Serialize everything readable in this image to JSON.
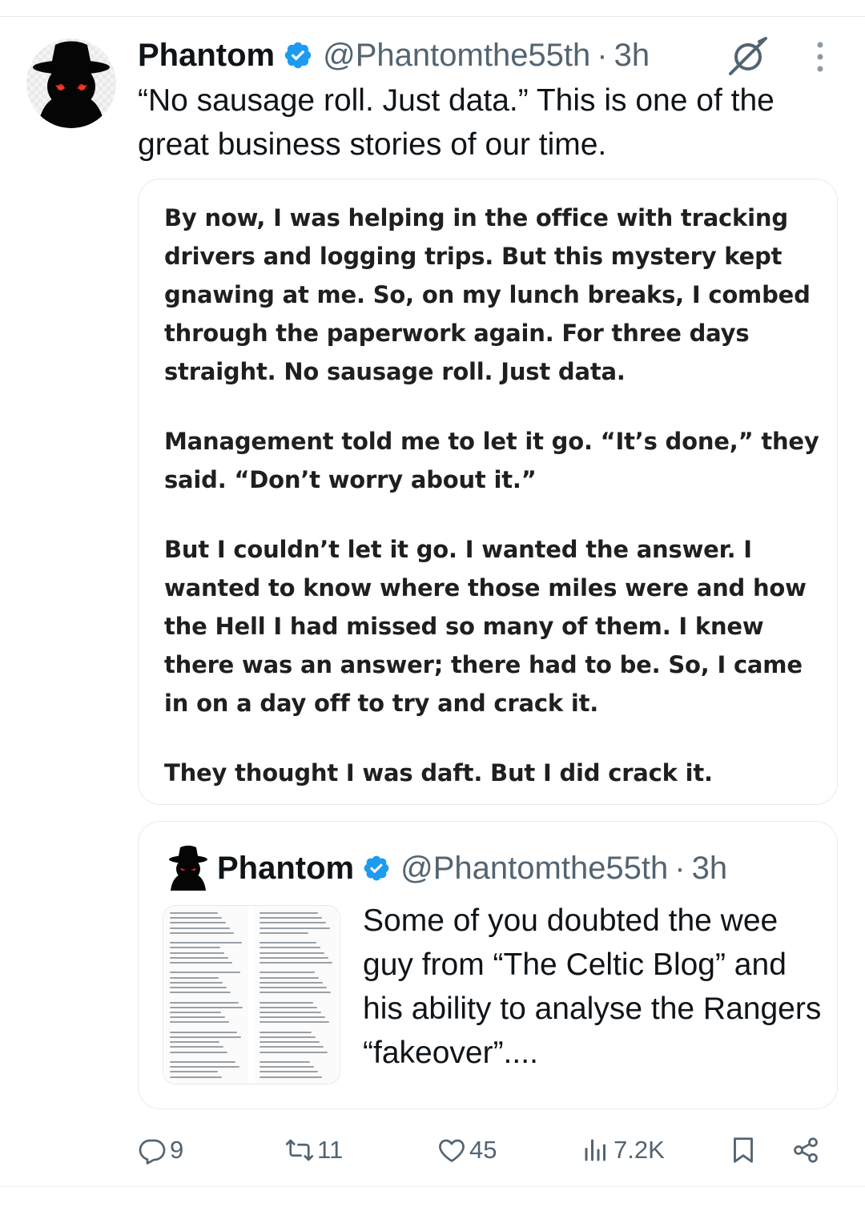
{
  "post": {
    "author_name": "Phantom",
    "handle": "@Phantomthe55th",
    "separator": "·",
    "time": "3h",
    "text": "“No sausage roll.  Just data.”  This is one of the great business stories of our time."
  },
  "attached_image": {
    "paragraphs": [
      "By now, I was helping in the office with tracking drivers and logging trips. But this mystery kept gnawing at me. So, on my lunch breaks, I combed through the paperwork again. For three days straight. No sausage roll. Just data.",
      "Management told me to let it go. “It’s done,” they said. “Don’t worry about it.”",
      "But I couldn’t let it go. I wanted the answer. I wanted to know where those miles were and how the Hell I had missed so many of them. I knew there was an answer; there had to be. So, I came in on a day off to try and crack it.",
      "They thought I was daft. But I did crack it."
    ]
  },
  "quoted_post": {
    "author_name": "Phantom",
    "handle": "@Phantomthe55th",
    "separator": "·",
    "time": "3h",
    "text": "Some of you doubted the wee guy from “The Celtic Blog” and his ability to analyse the Rangers “fakeover”...."
  },
  "actions": {
    "replies": "9",
    "reposts": "11",
    "likes": "45",
    "views": "7.2K"
  },
  "colors": {
    "verified": "#1d9bf0",
    "muted": "#536471",
    "text": "#0f1419",
    "avatar_eyes": "#ff2a1a"
  }
}
